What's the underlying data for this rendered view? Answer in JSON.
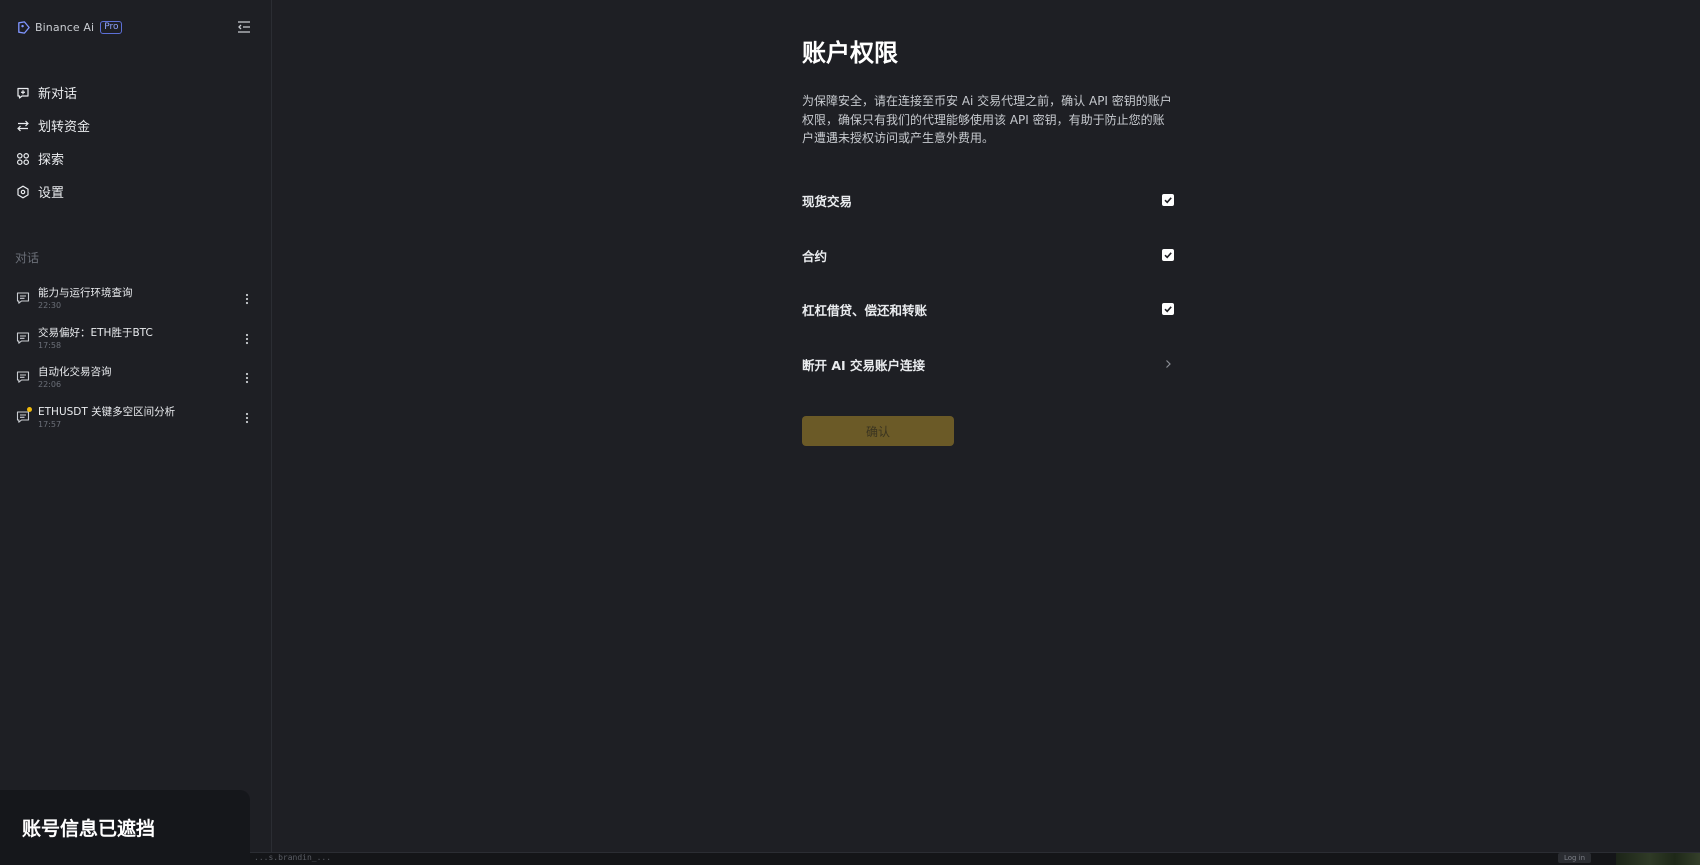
{
  "brand": {
    "name": "Binance Ai",
    "badge": "Pro"
  },
  "sidebar": {
    "nav": [
      {
        "label": "新对话",
        "icon": "new-chat-icon"
      },
      {
        "label": "划转资金",
        "icon": "transfer-icon"
      },
      {
        "label": "探索",
        "icon": "explore-icon"
      },
      {
        "label": "设置",
        "icon": "settings-icon"
      }
    ],
    "section_title": "对话",
    "conversations": [
      {
        "title": "能力与运行环境查询",
        "time": "22:30",
        "unread": false
      },
      {
        "title": "交易偏好：ETH胜于BTC",
        "time": "17:58",
        "unread": false
      },
      {
        "title": "自动化交易咨询",
        "time": "22:06",
        "unread": false
      },
      {
        "title": "ETHUSDT 关键多空区间分析",
        "time": "17:57",
        "unread": true
      }
    ],
    "masked_notice": "账号信息已遮挡"
  },
  "main": {
    "title": "账户权限",
    "description": "为保障安全，请在连接至币安 Ai 交易代理之前，确认 API 密钥的账户权限，确保只有我们的代理能够使用该 API 密钥，有助于防止您的账户遭遇未授权访问或产生意外费用。",
    "permissions": [
      {
        "label": "现货交易",
        "checked": true
      },
      {
        "label": "合约",
        "checked": true
      },
      {
        "label": "杠杠借贷、偿还和转账",
        "checked": true
      }
    ],
    "disconnect_label": "断开 AI 交易账户连接",
    "confirm_label": "确认"
  },
  "bottom_bar": {
    "faint_text": "...s.brandin_...",
    "login_label": "Log in"
  },
  "colors": {
    "background": "#1e1f24",
    "accent": "#f0b90b",
    "confirm_disabled": "#6b5a27"
  }
}
